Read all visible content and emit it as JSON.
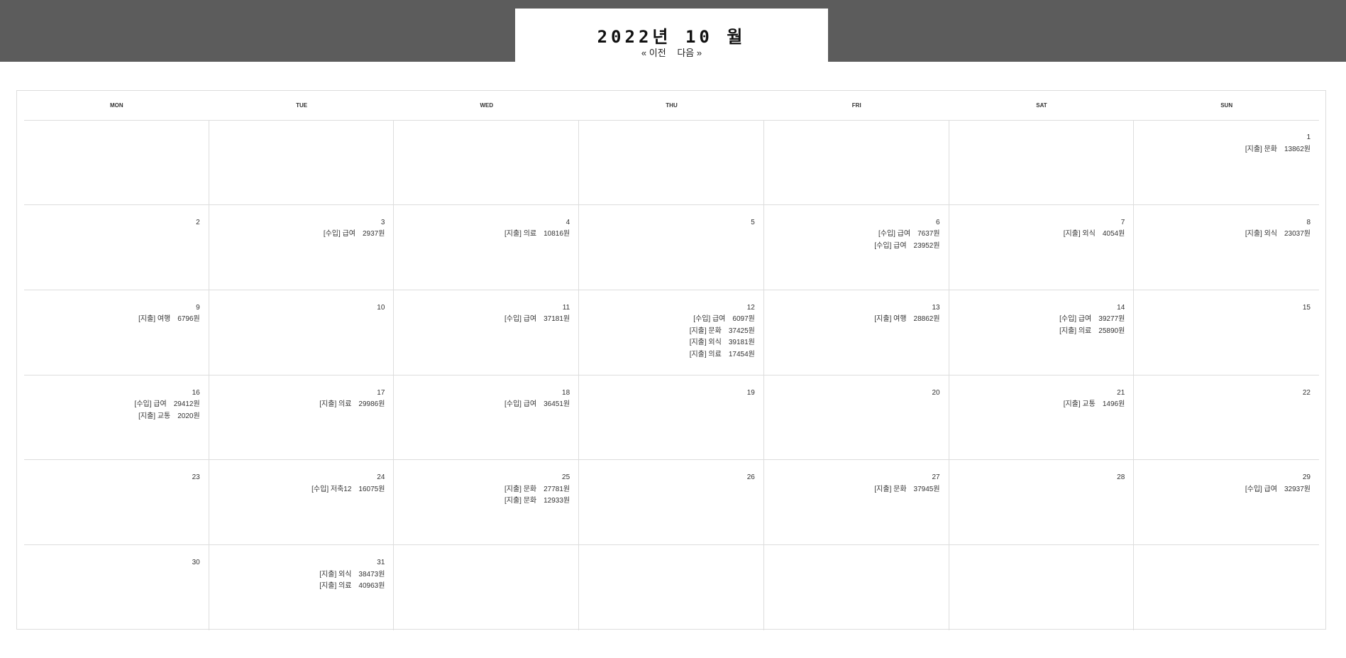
{
  "header": {
    "year_label": "2022년",
    "month_label": "10 월",
    "prev_label": "« 이전",
    "next_label": "다음 »"
  },
  "colors": {
    "topbar": "#5c5c5c",
    "grid_line": "#dddddd"
  },
  "weekdays": [
    "MON",
    "TUE",
    "WED",
    "THU",
    "FRI",
    "SAT",
    "SUN"
  ],
  "weeks": [
    [
      {
        "day": "",
        "entries": []
      },
      {
        "day": "",
        "entries": []
      },
      {
        "day": "",
        "entries": []
      },
      {
        "day": "",
        "entries": []
      },
      {
        "day": "",
        "entries": []
      },
      {
        "day": "",
        "entries": []
      },
      {
        "day": "1",
        "entries": [
          {
            "label": "[지출] 문화",
            "amount": "13862원"
          }
        ]
      }
    ],
    [
      {
        "day": "2",
        "entries": []
      },
      {
        "day": "3",
        "entries": [
          {
            "label": "[수입] 급여",
            "amount": "2937원"
          }
        ]
      },
      {
        "day": "4",
        "entries": [
          {
            "label": "[지출] 의료",
            "amount": "10816원"
          }
        ]
      },
      {
        "day": "5",
        "entries": []
      },
      {
        "day": "6",
        "entries": [
          {
            "label": "[수입] 급여",
            "amount": "7637원"
          },
          {
            "label": "[수입] 급여",
            "amount": "23952원"
          }
        ]
      },
      {
        "day": "7",
        "entries": [
          {
            "label": "[지출] 외식",
            "amount": "4054원"
          }
        ]
      },
      {
        "day": "8",
        "entries": [
          {
            "label": "[지출] 외식",
            "amount": "23037원"
          }
        ]
      }
    ],
    [
      {
        "day": "9",
        "entries": [
          {
            "label": "[지출] 여행",
            "amount": "6796원"
          }
        ]
      },
      {
        "day": "10",
        "entries": []
      },
      {
        "day": "11",
        "entries": [
          {
            "label": "[수입] 급여",
            "amount": "37181원"
          }
        ]
      },
      {
        "day": "12",
        "entries": [
          {
            "label": "[수입] 급여",
            "amount": "6097원"
          },
          {
            "label": "[지출] 문화",
            "amount": "37425원"
          },
          {
            "label": "[지출] 외식",
            "amount": "39181원"
          },
          {
            "label": "[지출] 의료",
            "amount": "17454원"
          }
        ]
      },
      {
        "day": "13",
        "entries": [
          {
            "label": "[지출] 여행",
            "amount": "28862원"
          }
        ]
      },
      {
        "day": "14",
        "entries": [
          {
            "label": "[수입] 급여",
            "amount": "39277원"
          },
          {
            "label": "[지출] 의료",
            "amount": "25890원"
          }
        ]
      },
      {
        "day": "15",
        "entries": []
      }
    ],
    [
      {
        "day": "16",
        "entries": [
          {
            "label": "[수입] 급여",
            "amount": "29412원"
          },
          {
            "label": "[지출] 교통",
            "amount": "2020원"
          }
        ]
      },
      {
        "day": "17",
        "entries": [
          {
            "label": "[지출] 의료",
            "amount": "29986원"
          }
        ]
      },
      {
        "day": "18",
        "entries": [
          {
            "label": "[수입] 급여",
            "amount": "36451원"
          }
        ]
      },
      {
        "day": "19",
        "entries": []
      },
      {
        "day": "20",
        "entries": []
      },
      {
        "day": "21",
        "entries": [
          {
            "label": "[지출] 교통",
            "amount": "1496원"
          }
        ]
      },
      {
        "day": "22",
        "entries": []
      }
    ],
    [
      {
        "day": "23",
        "entries": []
      },
      {
        "day": "24",
        "entries": [
          {
            "label": "[수입] 저축12",
            "amount": "16075원"
          }
        ]
      },
      {
        "day": "25",
        "entries": [
          {
            "label": "[지출] 문화",
            "amount": "27781원"
          },
          {
            "label": "[지출] 문화",
            "amount": "12933원"
          }
        ]
      },
      {
        "day": "26",
        "entries": []
      },
      {
        "day": "27",
        "entries": [
          {
            "label": "[지출] 문화",
            "amount": "37945원"
          }
        ]
      },
      {
        "day": "28",
        "entries": []
      },
      {
        "day": "29",
        "entries": [
          {
            "label": "[수입] 급여",
            "amount": "32937원"
          }
        ]
      }
    ],
    [
      {
        "day": "30",
        "entries": []
      },
      {
        "day": "31",
        "entries": [
          {
            "label": "[지출] 외식",
            "amount": "38473원"
          },
          {
            "label": "[지출] 의료",
            "amount": "40963원"
          }
        ]
      },
      {
        "day": "",
        "entries": []
      },
      {
        "day": "",
        "entries": []
      },
      {
        "day": "",
        "entries": []
      },
      {
        "day": "",
        "entries": []
      },
      {
        "day": "",
        "entries": []
      }
    ]
  ]
}
